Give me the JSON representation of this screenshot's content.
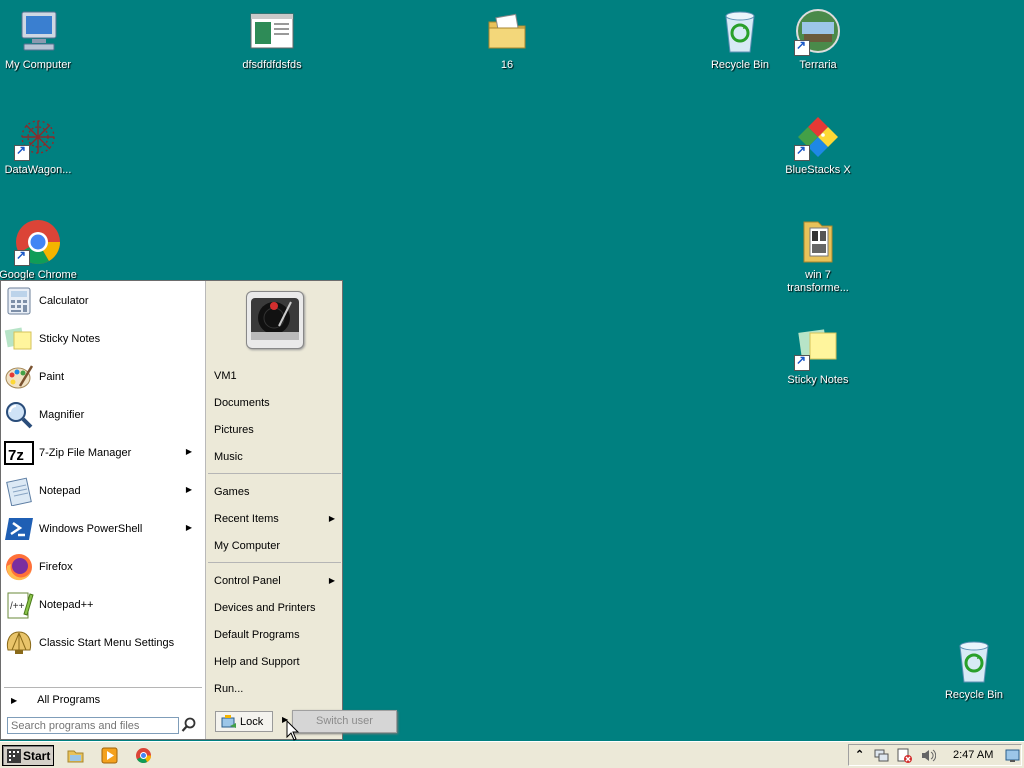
{
  "desktop": {
    "icons": [
      {
        "label": "My Computer",
        "icon": "my-computer-icon"
      },
      {
        "label": "dfsdfdfdsfds",
        "icon": "document-window-icon"
      },
      {
        "label": "16",
        "icon": "folder-icon"
      },
      {
        "label": "Recycle Bin",
        "icon": "recycle-bin-icon"
      },
      {
        "label": "Terraria",
        "icon": "terraria-icon"
      },
      {
        "label": "DataWagon...",
        "icon": "datawagon-icon"
      },
      {
        "label": "BlueStacks X",
        "icon": "bluestacks-icon"
      },
      {
        "label": "Google Chrome",
        "icon": "chrome-icon"
      },
      {
        "label": "win 7 transforme...",
        "icon": "folder-icon"
      },
      {
        "label": "Sticky Notes",
        "icon": "sticky-notes-icon"
      },
      {
        "label": "Recycle Bin",
        "icon": "recycle-bin-icon"
      }
    ]
  },
  "start_menu": {
    "programs": [
      {
        "label": "Calculator",
        "icon": "calculator-icon",
        "submenu": false
      },
      {
        "label": "Sticky Notes",
        "icon": "sticky-notes-icon",
        "submenu": false
      },
      {
        "label": "Paint",
        "icon": "paint-icon",
        "submenu": false
      },
      {
        "label": "Magnifier",
        "icon": "magnifier-icon",
        "submenu": false
      },
      {
        "label": "7-Zip File Manager",
        "icon": "7zip-icon",
        "submenu": true
      },
      {
        "label": "Notepad",
        "icon": "notepad-icon",
        "submenu": true
      },
      {
        "label": "Windows PowerShell",
        "icon": "powershell-icon",
        "submenu": true
      },
      {
        "label": "Firefox",
        "icon": "firefox-icon",
        "submenu": false
      },
      {
        "label": "Notepad++",
        "icon": "notepadpp-icon",
        "submenu": false
      },
      {
        "label": "Classic Start Menu Settings",
        "icon": "shell-icon",
        "submenu": false
      }
    ],
    "all_programs": "All Programs",
    "search_placeholder": "Search programs and files",
    "right_items": [
      {
        "label": "VM1",
        "submenu": false
      },
      {
        "label": "Documents",
        "submenu": false
      },
      {
        "label": "Pictures",
        "submenu": false
      },
      {
        "label": "Music",
        "submenu": false
      },
      {
        "label": "Games",
        "submenu": false
      },
      {
        "label": "Recent Items",
        "submenu": true
      },
      {
        "label": "My Computer",
        "submenu": false
      },
      {
        "label": "Control Panel",
        "submenu": true
      },
      {
        "label": "Devices and Printers",
        "submenu": false
      },
      {
        "label": "Default Programs",
        "submenu": false
      },
      {
        "label": "Help and Support",
        "submenu": false
      },
      {
        "label": "Run...",
        "submenu": false
      }
    ],
    "lock_label": "Lock",
    "switch_user_label": "Switch user"
  },
  "taskbar": {
    "start_label": "Start",
    "clock": "2:47 AM"
  },
  "colors": {
    "desktop": "#008080",
    "menu_right": "#ece9d8",
    "taskbar": "#ece9d8"
  }
}
